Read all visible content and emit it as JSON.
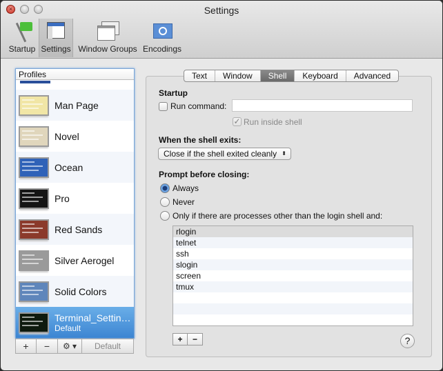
{
  "window": {
    "title": "Settings"
  },
  "toolbar": [
    {
      "label": "Startup",
      "icon": "flag-icon"
    },
    {
      "label": "Settings",
      "icon": "settings-icon",
      "selected": true
    },
    {
      "label": "Window Groups",
      "icon": "window-groups-icon"
    },
    {
      "label": "Encodings",
      "icon": "un-flag-icon"
    }
  ],
  "profiles": {
    "header": "Profiles",
    "items": [
      {
        "name": "Man Page",
        "color": "#f1e6a6"
      },
      {
        "name": "Novel",
        "color": "#e0d6bc"
      },
      {
        "name": "Ocean",
        "color": "#2f62b8"
      },
      {
        "name": "Pro",
        "color": "#151515"
      },
      {
        "name": "Red Sands",
        "color": "#8b3a2b"
      },
      {
        "name": "Silver Aerogel",
        "color": "#9a9a9a"
      },
      {
        "name": "Solid Colors",
        "color": "#5f86bb"
      },
      {
        "name": "Terminal_Settin…",
        "subtitle": "Default",
        "color": "#0e1a0e",
        "selected": true
      }
    ],
    "buttons": {
      "add": "+",
      "remove": "−",
      "gear": "⚙ ▾",
      "default": "Default"
    }
  },
  "tabs": [
    {
      "label": "Text"
    },
    {
      "label": "Window"
    },
    {
      "label": "Shell",
      "selected": true
    },
    {
      "label": "Keyboard"
    },
    {
      "label": "Advanced"
    }
  ],
  "shell": {
    "startup_heading": "Startup",
    "run_command_label": "Run command:",
    "run_command_checked": false,
    "run_command_value": "",
    "run_inside_shell_label": "Run inside shell",
    "run_inside_shell_checked": true,
    "exit_heading": "When the shell exits:",
    "exit_option": "Close if the shell exited cleanly",
    "prompt_heading": "Prompt before closing:",
    "prompt_options": [
      {
        "label": "Always",
        "selected": true
      },
      {
        "label": "Never"
      },
      {
        "label": "Only if there are processes other than the login shell and:"
      }
    ],
    "processes": [
      "rlogin",
      "telnet",
      "ssh",
      "slogin",
      "screen",
      "tmux"
    ],
    "add": "+",
    "remove": "−",
    "help": "?"
  }
}
